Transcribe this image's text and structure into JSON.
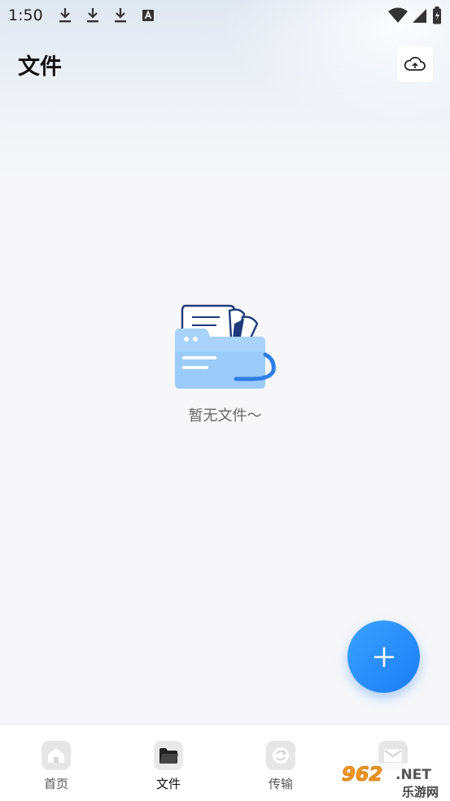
{
  "status_bar": {
    "time": "1:50",
    "left_icons": [
      "download-icon",
      "download-icon",
      "download-icon",
      "font-a-icon"
    ],
    "right_icons": [
      "wifi-icon",
      "signal-icon",
      "battery-icon"
    ]
  },
  "header": {
    "title": "文件",
    "cloud_icon": "cloud-sync-icon"
  },
  "empty_state": {
    "illustration": "folder-with-documents",
    "message": "暂无文件～"
  },
  "fab": {
    "icon": "plus-icon",
    "color": "#1a7df5"
  },
  "bottom_nav": {
    "items": [
      {
        "label": "首页",
        "icon": "home-icon",
        "active": false
      },
      {
        "label": "文件",
        "icon": "folder-icon",
        "active": true
      },
      {
        "label": "传输",
        "icon": "transfer-icon",
        "active": false
      },
      {
        "label": "",
        "icon": "mail-icon",
        "active": false
      }
    ]
  },
  "watermark": {
    "number": "962",
    "suffix": ".NET",
    "text": "乐游网"
  },
  "colors": {
    "accent": "#1a7df5",
    "background": "#f7f7f9"
  }
}
